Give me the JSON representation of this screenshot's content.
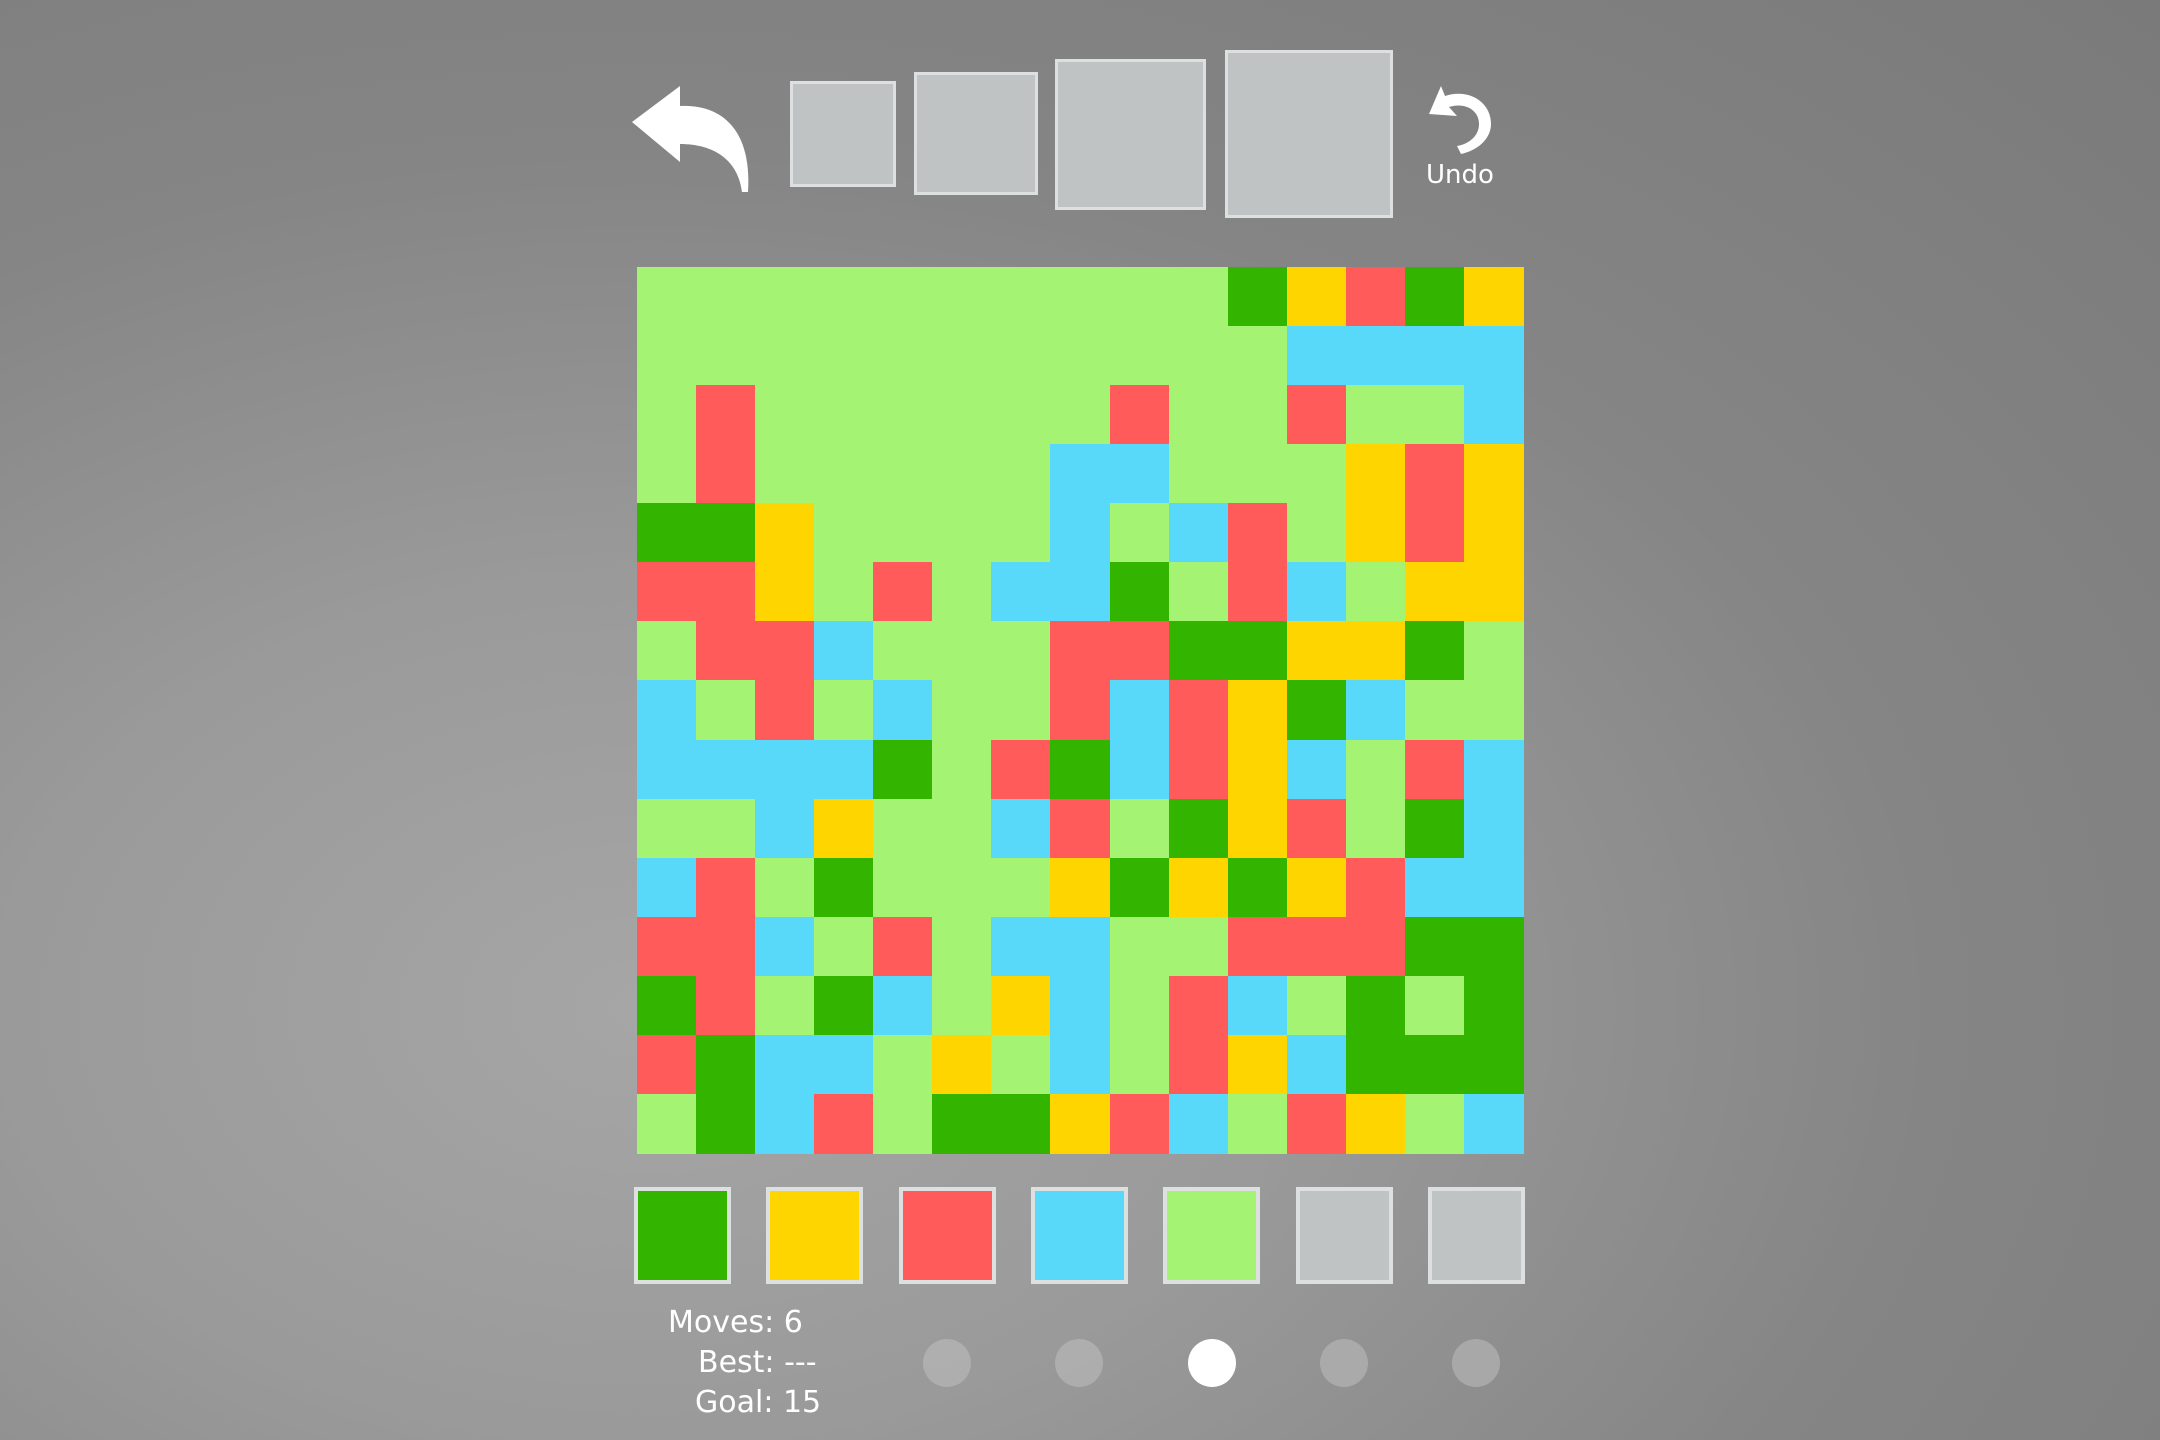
{
  "colors": {
    "green": "#33b500",
    "yellow": "#ffd500",
    "red": "#ff5b5b",
    "blue": "#58d9fa",
    "light": "#a5f373",
    "gray": "#bfc3c4"
  },
  "toolbar": {
    "back_icon": "back-arrow-icon",
    "undo_icon": "undo-icon",
    "undo_label": "Undo",
    "size_options": 4
  },
  "board": {
    "size": 15,
    "rows": [
      "LLLLLLLLLLGYRGY",
      "LLLLLLLLLLLBBBB",
      "LRLLLLLLRLLRLLB",
      "LRLLLLLBBLLLYRY",
      "GGYLLLLBLBRLYRY",
      "RRYLRLBBGLRBLYY",
      "LRRBLLLRRGGYYGL",
      "BLRLBLLRBRYGBLL",
      "BBBBGLRGBRYBLRB",
      "LLBYLLBRLGYRLGB",
      "BRLGLLLYGYGYRBB",
      "RRBLRLBBLLRRRGG",
      "GRLGBLYBLRBLGLG",
      "RGBBLYLBLRYBGGG",
      "LGBRLGGYRBLRYLB"
    ]
  },
  "palette": [
    "green",
    "yellow",
    "red",
    "blue",
    "light",
    "gray",
    "gray"
  ],
  "stats": {
    "moves": "Moves: 6",
    "best": "Best: ---",
    "goal": "Goal: 15"
  },
  "pages": {
    "count": 5,
    "active_index": 2
  }
}
